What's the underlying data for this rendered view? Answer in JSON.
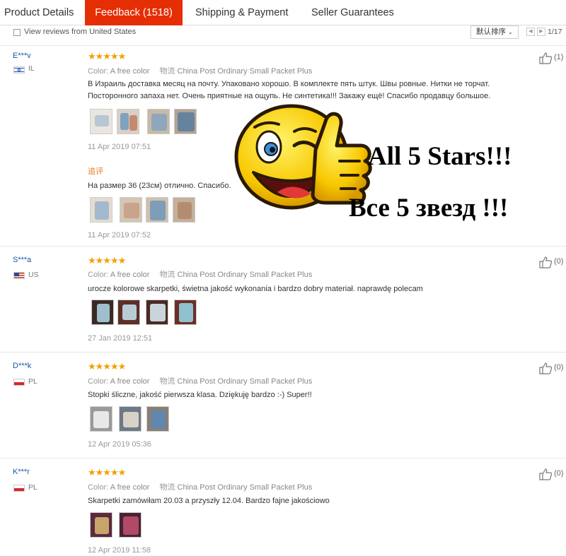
{
  "tabs": [
    {
      "label": "Product Details",
      "active": false
    },
    {
      "label": "Feedback (1518)",
      "active": true
    },
    {
      "label": "Shipping & Payment",
      "active": false
    },
    {
      "label": "Seller Guarantees",
      "active": false
    }
  ],
  "filter": {
    "checkbox_label": "View reviews from United States",
    "sort_label": "默认排序",
    "page": "1/17"
  },
  "colors": {
    "accent": "#e62e04",
    "star": "#f2a000",
    "username": "#1a56a8",
    "additional": "#e67e22"
  },
  "reviews": [
    {
      "user": "E***v",
      "country": "IL",
      "flag_icon": "israel-flag-icon",
      "rating": 5,
      "stars": "★★★★★",
      "color_label": "Color:",
      "color_value": "A free color",
      "logistics_label": "物流",
      "logistics_value": "China Post Ordinary Small Packet Plus",
      "text": "В Израиль доставка месяц на почту. Упаковано хорошо. В комплекте пять штук. Швы ровные. Нитки не торчат. Посторонного запаха нет. Очень приятные на ощупь. Не синтетика!!! Закажу ещё! Спасибо продавцу большое.",
      "photos": 4,
      "date": "11 Apr 2019 07:51",
      "additional_label": "追评",
      "additional_text": "На размер 36 (23см) отлично. Спасибо.",
      "additional_photos": 4,
      "additional_date": "11 Apr 2019 07:52",
      "likes": "(1)"
    },
    {
      "user": "S***a",
      "country": "US",
      "flag_icon": "us-flag-icon",
      "rating": 5,
      "stars": "★★★★★",
      "color_label": "Color:",
      "color_value": "A free color",
      "logistics_label": "物流",
      "logistics_value": "China Post Ordinary Small Packet Plus",
      "text": "urocze kolorowe skarpetki, świetna jakość wykonania i bardzo dobry materiał. naprawdę polecam",
      "photos": 4,
      "date": "27 Jan 2019 12:51",
      "likes": "(0)"
    },
    {
      "user": "D***k",
      "country": "PL",
      "flag_icon": "poland-flag-icon",
      "rating": 5,
      "stars": "★★★★★",
      "color_label": "Color:",
      "color_value": "A free color",
      "logistics_label": "物流",
      "logistics_value": "China Post Ordinary Small Packet Plus",
      "text": "Stopki śliczne, jakość pierwsza klasa. Dziękuję bardzo :-) Super!!",
      "photos": 3,
      "date": "12 Apr 2019 05:36",
      "likes": "(0)"
    },
    {
      "user": "K***r",
      "country": "PL",
      "flag_icon": "poland-flag-icon",
      "rating": 5,
      "stars": "★★★★★",
      "color_label": "Color:",
      "color_value": "A free color",
      "logistics_label": "物流",
      "logistics_value": "China Post Ordinary Small Packet Plus",
      "text": "Skarpetki zamówiłam 20.03 a przyszły 12.04. Bardzo fajne jakościowo",
      "photos": 2,
      "date": "12 Apr 2019 11:58",
      "likes": "(0)"
    }
  ],
  "promo": {
    "line1": "All 5 Stars!!!",
    "line2": "Все 5 звезд !!!",
    "icon": "winking-thumbs-up-emoji-icon"
  }
}
